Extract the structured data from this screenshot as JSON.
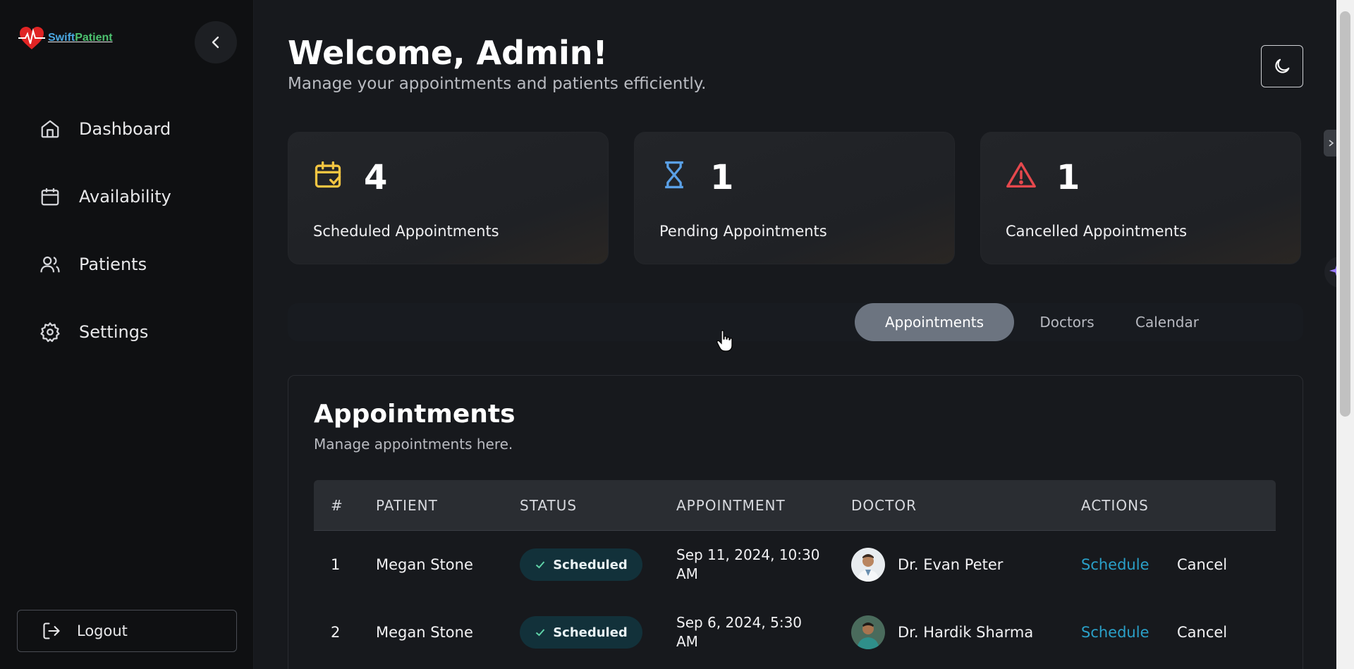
{
  "app": {
    "logo_part1": "Swift",
    "logo_part2": "Patient"
  },
  "sidebar": {
    "items": [
      {
        "label": "Dashboard",
        "icon": "home-icon"
      },
      {
        "label": "Availability",
        "icon": "calendar-icon"
      },
      {
        "label": "Patients",
        "icon": "users-icon"
      },
      {
        "label": "Settings",
        "icon": "gear-icon"
      }
    ],
    "logout_label": "Logout"
  },
  "header": {
    "title": "Welcome, Admin!",
    "subtitle": "Manage your appointments and patients efficiently."
  },
  "stats": [
    {
      "count": "4",
      "label": "Scheduled Appointments",
      "icon": "calendar-check-icon",
      "color": "#f4c542"
    },
    {
      "count": "1",
      "label": "Pending Appointments",
      "icon": "hourglass-icon",
      "color": "#5aa0e6"
    },
    {
      "count": "1",
      "label": "Cancelled Appointments",
      "icon": "warning-icon",
      "color": "#e5484d"
    }
  ],
  "tabs": [
    {
      "label": "Appointments",
      "active": true
    },
    {
      "label": "Doctors",
      "active": false
    },
    {
      "label": "Calendar",
      "active": false
    }
  ],
  "panel": {
    "title": "Appointments",
    "subtitle": "Manage appointments here."
  },
  "table": {
    "headers": [
      "#",
      "PATIENT",
      "STATUS",
      "APPOINTMENT",
      "DOCTOR",
      "ACTIONS"
    ],
    "rows": [
      {
        "num": "1",
        "patient": "Megan Stone",
        "status": "Scheduled",
        "appt_line1": "Sep 11, 2024, 10:30",
        "appt_line2": "AM",
        "doctor": "Dr. Evan Peter",
        "action1": "Schedule",
        "action2": "Cancel"
      },
      {
        "num": "2",
        "patient": "Megan Stone",
        "status": "Scheduled",
        "appt_line1": "Sep 6, 2024, 5:30",
        "appt_line2": "AM",
        "doctor": "Dr. Hardik Sharma",
        "action1": "Schedule",
        "action2": "Cancel"
      }
    ]
  },
  "colors": {
    "accent_link": "#2aa0c8",
    "badge_bg": "#12313a"
  }
}
